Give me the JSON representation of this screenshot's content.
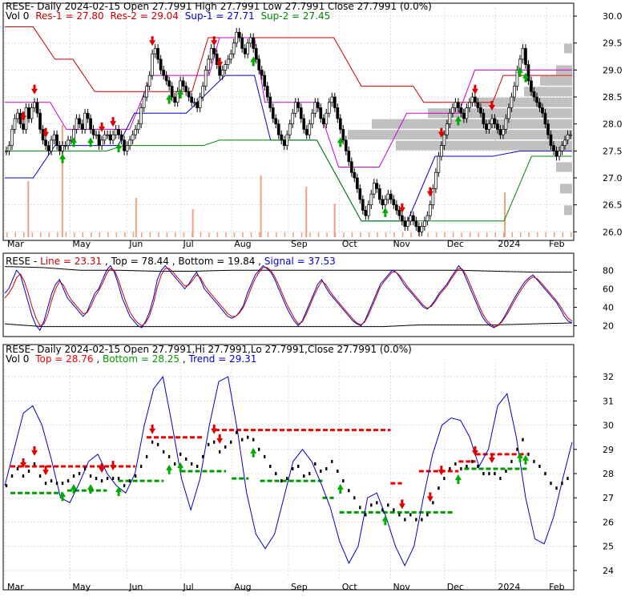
{
  "chart_data": [
    {
      "type": "candlestick",
      "panel": "price",
      "header": {
        "symbol": "RESE",
        "text": "- Daily 2024-02-15 Open 27.7991  High 27.7991  Low 27.7991  Close 27.7991 (0.0%)",
        "vol": "Vol 0",
        "res1": "Res-1 = 27.80",
        "res2": "Res-2 = 29.04",
        "sup1": "Sup-1 = 27.71",
        "sup2": "Sup-2 = 27.45"
      },
      "ylim": [
        25.9,
        30.15
      ],
      "y_ticks": [
        26.0,
        26.5,
        27.0,
        27.5,
        28.0,
        28.5,
        29.0,
        29.5,
        30.0
      ],
      "y_tick_labels": [
        "26.0",
        "26.5",
        "27.0",
        "27.5",
        "28.0",
        "28.5",
        "29.0",
        "29.5",
        "30.0"
      ],
      "x_labels": [
        "Mar",
        "May",
        "Jun",
        "Jul",
        "Aug",
        "Sep",
        "Oct",
        "Nov",
        "Dec",
        "2024",
        "Feb"
      ],
      "close_series": [
        27.5,
        27.6,
        27.9,
        28.1,
        28.2,
        28.0,
        27.9,
        28.3,
        28.1,
        28.3,
        28.4,
        28.2,
        27.9,
        27.7,
        27.6,
        27.5,
        27.7,
        27.8,
        27.6,
        27.5,
        27.6,
        27.6,
        27.7,
        27.7,
        27.9,
        28.1,
        28.0,
        27.9,
        28.2,
        28.1,
        27.9,
        27.8,
        27.8,
        27.6,
        27.7,
        27.8,
        27.8,
        27.7,
        27.8,
        27.9,
        27.8,
        27.7,
        27.5,
        27.6,
        27.7,
        27.8,
        27.9,
        28.0,
        28.3,
        28.5,
        28.7,
        28.9,
        29.3,
        29.4,
        29.2,
        29.0,
        28.9,
        28.8,
        28.7,
        28.5,
        28.4,
        28.6,
        28.8,
        28.7,
        28.6,
        28.5,
        28.4,
        28.4,
        28.3,
        28.5,
        28.7,
        29.0,
        29.2,
        29.4,
        29.3,
        29.1,
        28.9,
        29.0,
        29.1,
        29.2,
        29.3,
        29.5,
        29.7,
        29.6,
        29.4,
        29.3,
        29.5,
        29.6,
        29.4,
        29.2,
        29.0,
        28.9,
        28.7,
        28.5,
        28.3,
        28.1,
        28.0,
        27.8,
        27.7,
        27.6,
        27.8,
        28.0,
        28.2,
        28.4,
        28.3,
        28.1,
        27.9,
        27.8,
        28.0,
        28.2,
        28.4,
        28.3,
        28.1,
        28.0,
        28.2,
        28.4,
        28.5,
        28.3,
        28.1,
        27.9,
        27.7,
        27.5,
        27.3,
        27.1,
        27.0,
        26.8,
        26.6,
        26.4,
        26.3,
        26.5,
        26.7,
        26.9,
        26.8,
        26.6,
        26.5,
        26.6,
        26.7,
        26.6,
        26.5,
        26.4,
        26.3,
        26.2,
        26.1,
        26.2,
        26.3,
        26.2,
        26.1,
        26.0,
        26.1,
        26.2,
        26.3,
        26.5,
        26.8,
        27.1,
        27.4,
        27.6,
        27.8,
        28.0,
        28.2,
        28.3,
        28.4,
        28.3,
        28.2,
        28.1,
        28.3,
        28.4,
        28.5,
        28.4,
        28.3,
        28.2,
        28.0,
        27.9,
        28.0,
        28.1,
        28.0,
        27.9,
        27.8,
        27.9,
        28.1,
        28.3,
        28.5,
        28.7,
        29.0,
        29.2,
        29.4,
        29.1,
        28.8,
        28.6,
        28.5,
        28.4,
        28.3,
        28.2,
        28.0,
        27.8,
        27.6,
        27.5,
        27.4,
        27.5,
        27.6,
        27.7,
        27.8,
        27.8
      ],
      "volume_spike_positions": [
        0.04,
        0.1,
        0.23,
        0.33,
        0.45,
        0.53,
        0.58,
        0.88
      ],
      "volume_spike_heights": [
        0.5,
        1.0,
        0.35,
        0.25,
        0.55,
        0.45,
        0.3,
        0.4
      ],
      "levels": {
        "res1": 27.8,
        "res2": 29.04,
        "sup1": 27.71,
        "sup2": 27.45
      },
      "colors": {
        "res1": "#cc0000",
        "res2": "#cc00cc",
        "sup1": "#0000cc",
        "sup2": "#008800",
        "volume": "#f0a080",
        "profile": "#b0b0b0"
      }
    },
    {
      "type": "line",
      "panel": "stochastic",
      "header": {
        "symbol": "RESE",
        "line": "Line = 23.31",
        "top": "Top = 78.44",
        "bottom": "Bottom = 19.84",
        "signal": "Signal = 37.53"
      },
      "ylim": [
        10,
        95
      ],
      "y_ticks": [
        20,
        40,
        60,
        80
      ],
      "y_tick_labels": [
        "20",
        "40",
        "60",
        "80"
      ],
      "series": [
        {
          "key": "line",
          "color": "#0000cc",
          "values": [
            55,
            60,
            70,
            80,
            75,
            60,
            45,
            30,
            20,
            15,
            25,
            40,
            55,
            65,
            70,
            60,
            50,
            45,
            40,
            35,
            30,
            35,
            45,
            55,
            60,
            70,
            80,
            85,
            78,
            65,
            50,
            40,
            30,
            25,
            20,
            18,
            25,
            35,
            50,
            70,
            80,
            85,
            80,
            75,
            70,
            65,
            60,
            65,
            72,
            78,
            70,
            60,
            55,
            50,
            45,
            40,
            35,
            30,
            28,
            30,
            35,
            42,
            55,
            65,
            75,
            80,
            85,
            82,
            78,
            70,
            60,
            50,
            40,
            32,
            25,
            20,
            25,
            35,
            45,
            55,
            65,
            70,
            62,
            55,
            50,
            45,
            40,
            35,
            30,
            25,
            22,
            20,
            25,
            35,
            45,
            55,
            65,
            70,
            75,
            80,
            78,
            72,
            65,
            60,
            55,
            50,
            45,
            40,
            38,
            42,
            48,
            55,
            60,
            65,
            72,
            78,
            85,
            80,
            70,
            60,
            50,
            40,
            30,
            24,
            20,
            18,
            20,
            25,
            32,
            40,
            48,
            55,
            62,
            68,
            72,
            75,
            70,
            65,
            60,
            55,
            50,
            45,
            38,
            30,
            25,
            23
          ]
        },
        {
          "key": "signal",
          "color": "#cc0000",
          "values": [
            50,
            55,
            62,
            72,
            76,
            68,
            55,
            40,
            28,
            20,
            22,
            32,
            48,
            60,
            68,
            64,
            55,
            48,
            43,
            38,
            33,
            34,
            41,
            51,
            58,
            66,
            76,
            82,
            80,
            70,
            57,
            45,
            35,
            28,
            23,
            20,
            23,
            31,
            44,
            62,
            75,
            82,
            82,
            78,
            73,
            68,
            63,
            64,
            69,
            75,
            72,
            64,
            58,
            53,
            48,
            43,
            38,
            33,
            30,
            30,
            34,
            40,
            50,
            61,
            71,
            78,
            83,
            83,
            80,
            73,
            64,
            54,
            44,
            36,
            28,
            22,
            24,
            32,
            42,
            52,
            61,
            68,
            65,
            58,
            52,
            47,
            42,
            37,
            32,
            27,
            23,
            21,
            24,
            32,
            42,
            52,
            62,
            68,
            73,
            78,
            78,
            74,
            68,
            62,
            57,
            52,
            47,
            42,
            39,
            41,
            46,
            53,
            58,
            63,
            70,
            76,
            82,
            81,
            74,
            64,
            54,
            44,
            34,
            27,
            22,
            19,
            20,
            24,
            30,
            37,
            45,
            52,
            59,
            65,
            70,
            73,
            71,
            67,
            62,
            57,
            52,
            47,
            41,
            34,
            28,
            25
          ]
        }
      ],
      "top_band": [
        84,
        83,
        80,
        80,
        79,
        79,
        80,
        80,
        80,
        80,
        80,
        80,
        80,
        79,
        78,
        78
      ],
      "bottom_band": [
        22,
        19,
        19,
        19,
        19,
        19,
        19,
        19,
        19,
        19,
        19,
        21,
        21,
        21,
        22,
        23
      ]
    },
    {
      "type": "line",
      "panel": "trend",
      "header": {
        "symbol": "RESE",
        "text": "- Daily 2024-02-15 Open 27.7991,Hi 27.7991,Lo 27.7991,Close 27.7991 (0.0%)",
        "vol": "Vol 0",
        "top": "Top = 28.76",
        "bottom": "Bottom = 28.25",
        "trend": "Trend = 29.31"
      },
      "ylim": [
        23.6,
        32.6
      ],
      "y_ticks": [
        24,
        25,
        26,
        27,
        28,
        29,
        30,
        31,
        32
      ],
      "y_tick_labels": [
        "24",
        "25",
        "26",
        "27",
        "28",
        "29",
        "30",
        "31",
        "32"
      ],
      "x_labels": [
        "Mar",
        "May",
        "Jun",
        "Jul",
        "Aug",
        "Sep",
        "Oct",
        "Nov",
        "Dec",
        "2024",
        "Feb"
      ],
      "trend_values": [
        27.5,
        29,
        30.5,
        30.8,
        30,
        28.6,
        27,
        26.8,
        27.6,
        28.5,
        28.8,
        28,
        27.5,
        27.2,
        28,
        30,
        31.5,
        32,
        30,
        27.8,
        26.5,
        27.8,
        30,
        31.8,
        32,
        29.8,
        27.2,
        25.5,
        24.9,
        25.5,
        27,
        28.5,
        29,
        28.5,
        27.6,
        26.6,
        25.2,
        24.3,
        25,
        27,
        27.2,
        26.2,
        25,
        24.2,
        25,
        27,
        28.8,
        30,
        30.3,
        30.2,
        29.5,
        28.3,
        29,
        30.8,
        31.3,
        29.5,
        27,
        25.3,
        25.1,
        26.2,
        27.8,
        29.3
      ],
      "top_lines": [
        [
          28.3,
          0.01,
          0.23
        ],
        [
          29.5,
          0.25,
          0.35
        ],
        [
          29.8,
          0.37,
          0.68
        ],
        [
          27.6,
          0.68,
          0.7
        ],
        [
          28.1,
          0.73,
          0.8
        ],
        [
          28.5,
          0.8,
          0.83
        ],
        [
          28.8,
          0.83,
          0.92
        ]
      ],
      "bottom_lines": [
        [
          27.2,
          0.01,
          0.1
        ],
        [
          27.3,
          0.11,
          0.18
        ],
        [
          27.7,
          0.2,
          0.28
        ],
        [
          28.1,
          0.31,
          0.39
        ],
        [
          27.8,
          0.4,
          0.43
        ],
        [
          27.7,
          0.45,
          0.56
        ],
        [
          27.0,
          0.56,
          0.58
        ],
        [
          26.4,
          0.59,
          0.79
        ],
        [
          28.2,
          0.81,
          0.92
        ]
      ],
      "colors": {
        "top": "#ee0000",
        "bottom": "#009900",
        "trend": "#0000cc"
      }
    }
  ]
}
